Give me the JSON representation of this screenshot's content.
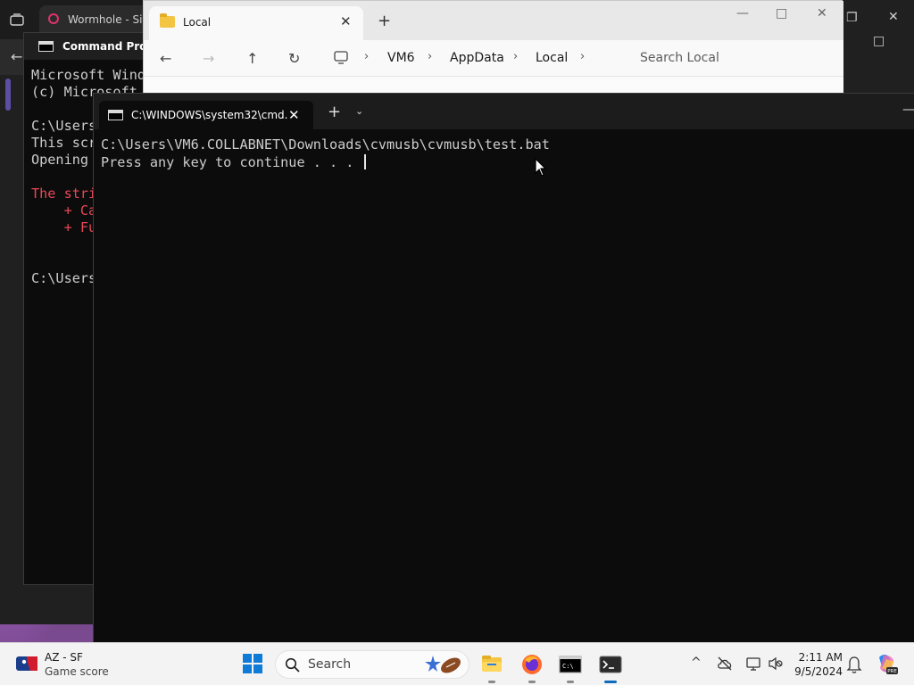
{
  "browser": {
    "tab_title": "Wormhole - Sim"
  },
  "cmd_back": {
    "title": "Command Prom",
    "lines": [
      "Microsoft Wind",
      "(c) Microsoft",
      "",
      "C:\\Users",
      "This scr",
      "Opening",
      "",
      "The stri",
      "    + Ca",
      "    + Fu",
      "",
      "",
      "C:\\Users"
    ]
  },
  "explorer": {
    "tab_title": "Local",
    "breadcrumb": [
      "VM6",
      "AppData",
      "Local"
    ],
    "search_placeholder": "Search Local"
  },
  "cmd_front": {
    "tab_title": "C:\\WINDOWS\\system32\\cmd.",
    "terminal_lines": [
      "C:\\Users\\VM6.COLLABNET\\Downloads\\cvmusb\\cvmusb\\test.bat",
      "Press any key to continue . . . "
    ]
  },
  "taskbar": {
    "widget_line1": "AZ - SF",
    "widget_line2": "Game score",
    "search_placeholder": "Search",
    "clock_time": "2:11 AM",
    "clock_date": "9/5/2024",
    "apps": [
      "file-explorer",
      "firefox",
      "command-prompt",
      "terminal"
    ],
    "active_app": "terminal"
  },
  "colors": {
    "terminal_bg": "#0c0c0c",
    "terminal_fg": "#cccccc",
    "error_red": "#e74856",
    "accent": "#0f6cbd",
    "folder_yellow": "#f4c542"
  }
}
